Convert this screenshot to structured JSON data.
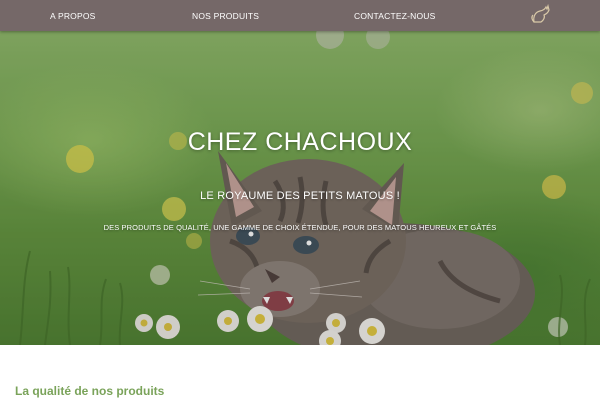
{
  "nav": {
    "items": [
      {
        "label": "A PROPOS"
      },
      {
        "label": "NOS PRODUITS"
      },
      {
        "label": "CONTACTEZ-NOUS"
      }
    ],
    "logo_icon": "cat-logo-icon"
  },
  "hero": {
    "title": "CHEZ CHACHOUX",
    "subtitle": "LE ROYAUME DES PETITS MATOUS !",
    "tagline": "DES PRODUITS DE QUALITÉ, UNE GAMME DE CHOIX ÉTENDUE, POUR DES MATOUS HEUREUX ET GÂTÉS"
  },
  "section": {
    "title": "La qualité de nos produits"
  },
  "colors": {
    "navbar": "#756868",
    "section_title": "#7aa35a",
    "hero_text": "#ffffff"
  }
}
